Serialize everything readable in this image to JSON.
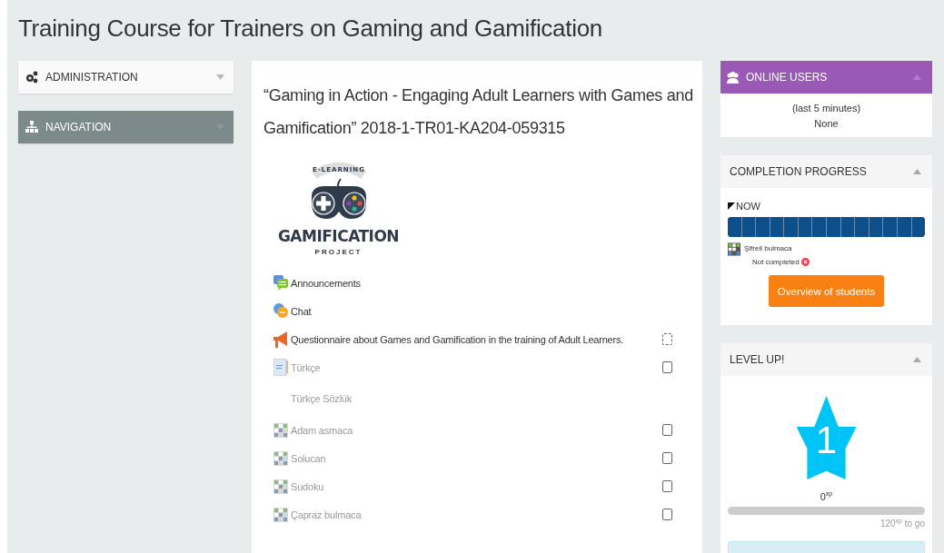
{
  "page_title": "Training Course for Trainers on Gaming and Gamification",
  "left_blocks": [
    {
      "title": "ADMINISTRATION",
      "kind": "admin",
      "dark": false
    },
    {
      "title": "NAVIGATION",
      "kind": "nav",
      "dark": true
    }
  ],
  "course": {
    "heading": "“Gaming in Action - Engaging Adult Learners with Games and Gamification” 2018-1-TR01-KA204-059315",
    "logo": {
      "top": "E-LEARNING",
      "name": "GAMIFICATION",
      "sub": "PROJECT"
    },
    "items": [
      {
        "kind": "forum",
        "label": "Announcements",
        "dimmed": false
      },
      {
        "kind": "chat",
        "label": "Chat",
        "dimmed": false
      },
      {
        "kind": "feedback",
        "label": "Questionnaire about Games and Gamification in the training of Adult Learners.",
        "dimmed": false,
        "checkbox": {
          "kind": "auto",
          "checked": false
        }
      },
      {
        "kind": "glossary",
        "label": "Türkçe",
        "dimmed": true,
        "checkbox": {
          "kind": "manual",
          "checked": false
        }
      },
      {
        "kind": "label",
        "label": "Türkçe Sözlük",
        "dimmed": true
      },
      {
        "kind": "game",
        "label": "Adam asmaca",
        "dimmed": true,
        "checkbox": {
          "kind": "manual",
          "checked": false
        }
      },
      {
        "kind": "game",
        "label": "Solucan",
        "dimmed": true,
        "checkbox": {
          "kind": "manual",
          "checked": false
        }
      },
      {
        "kind": "game",
        "label": "Sudoku",
        "dimmed": true,
        "checkbox": {
          "kind": "manual",
          "checked": false
        }
      },
      {
        "kind": "game",
        "label": "Çapraz bulmaca",
        "dimmed": true,
        "checkbox": {
          "kind": "manual",
          "checked": false
        }
      }
    ]
  },
  "online_users": {
    "title": "ONLINE USERS",
    "period": "(last 5 minutes)",
    "list": "None"
  },
  "completion_progress": {
    "title": "COMPLETION PROGRESS",
    "now": "NOW",
    "segments": [
      {
        "done": false
      },
      {
        "done": false
      },
      {
        "done": false
      },
      {
        "done": false
      },
      {
        "done": false
      },
      {
        "done": false
      },
      {
        "done": false
      },
      {
        "done": false
      },
      {
        "done": false
      },
      {
        "done": false
      },
      {
        "done": false
      },
      {
        "done": false
      },
      {
        "done": false
      },
      {
        "done": false
      }
    ],
    "activity": "Şifreli bulmaca",
    "status": "Not completed",
    "completed": false,
    "button": "Overview of students"
  },
  "level_up": {
    "title": "LEVEL UP!",
    "level": "1",
    "xp": "0$^{xp}$",
    "progress": {
      "level": 0
    },
    "to_go": "120$^{xp}$ to go"
  }
}
